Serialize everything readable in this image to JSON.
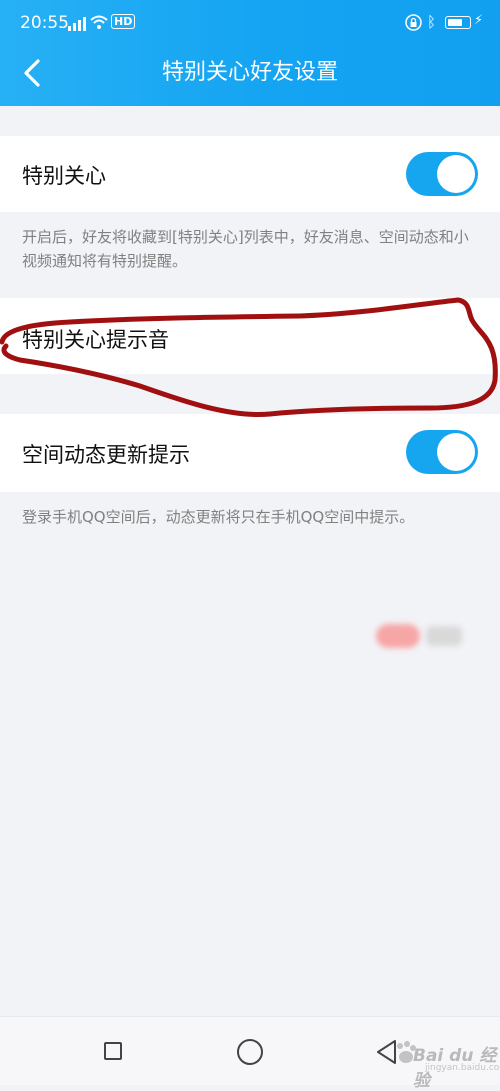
{
  "status_bar": {
    "time": "20:55",
    "network_badge": "HD"
  },
  "header": {
    "title": "特别关心好友设置"
  },
  "settings": {
    "special_care": {
      "label": "特别关心",
      "enabled": true,
      "description": "开启后，好友将收藏到[特别关心]列表中，好友消息、空间动态和小视频通知将有特别提醒。"
    },
    "special_care_sound": {
      "label": "特别关心提示音"
    },
    "space_update_notice": {
      "label": "空间动态更新提示",
      "enabled": true,
      "description": "登录手机QQ空间后，动态更新将只在手机QQ空间中提示。"
    }
  },
  "watermark": {
    "text": "Bai du 经验",
    "sub": "jingyan.baidu.com"
  },
  "colors": {
    "header_blue": "#14a4f2",
    "toggle_on": "#16a6f0",
    "annotation_red": "#a01010",
    "page_bg": "#f2f3f7"
  }
}
